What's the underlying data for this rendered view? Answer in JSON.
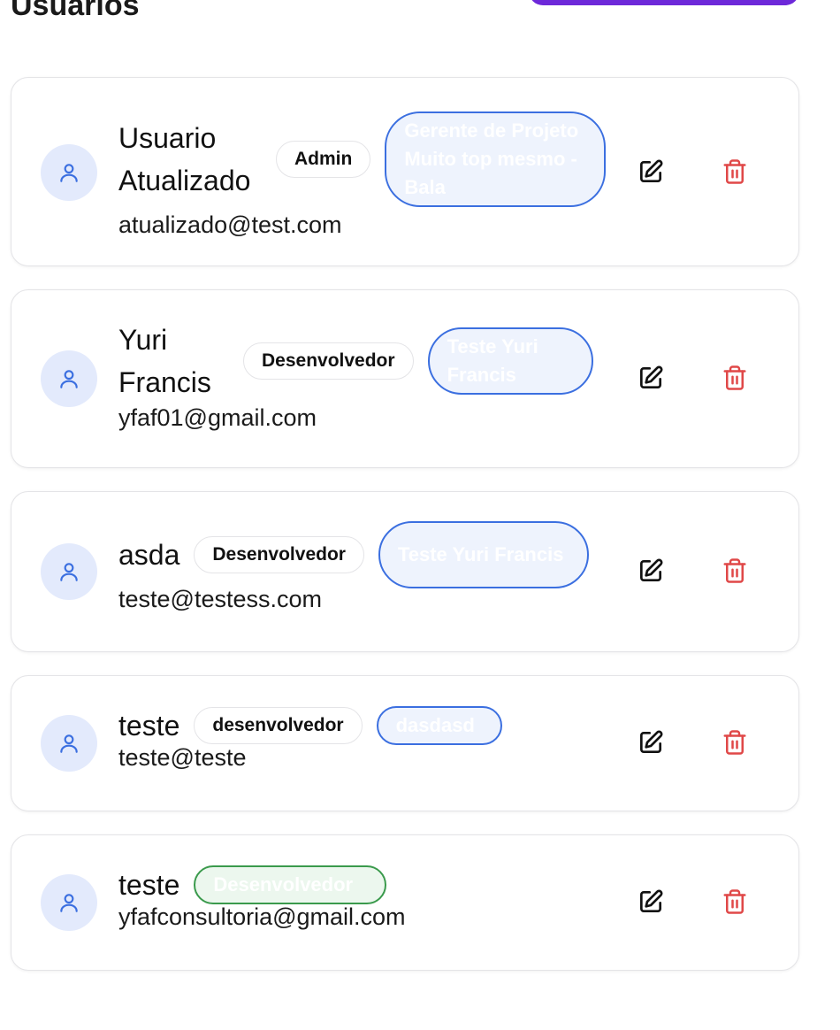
{
  "page": {
    "title": "Usuarios"
  },
  "users": [
    {
      "name": "Usuario Atualizado",
      "email": "atualizado@test.com",
      "role": "Admin",
      "position": "Gerente de Projeto Muito top mesmo - Bala"
    },
    {
      "name": "Yuri Francis",
      "email": "yfaf01@gmail.com",
      "role": "Desenvolvedor",
      "position": "Teste Yuri Francis"
    },
    {
      "name": "asda",
      "email": "teste@testess.com",
      "role": "Desenvolvedor",
      "position": "Teste Yuri Francis"
    },
    {
      "name": "teste",
      "email": "teste@teste",
      "role": "desenvolvedor",
      "position": "dasdasd"
    },
    {
      "name": "teste",
      "email": "yfafconsultoria@gmail.com",
      "position": "Desenvolvedor"
    }
  ],
  "colors": {
    "primary_button": "#6d28d9",
    "avatar_bg": "#e3eafc",
    "avatar_icon": "#3b6fe0",
    "position_border_blue": "#3b6fe0",
    "position_border_green": "#3a9a4c",
    "delete_icon": "#e04848"
  },
  "icons": {
    "avatar": "user-icon",
    "edit": "pencil-square-icon",
    "delete": "trash-icon"
  }
}
